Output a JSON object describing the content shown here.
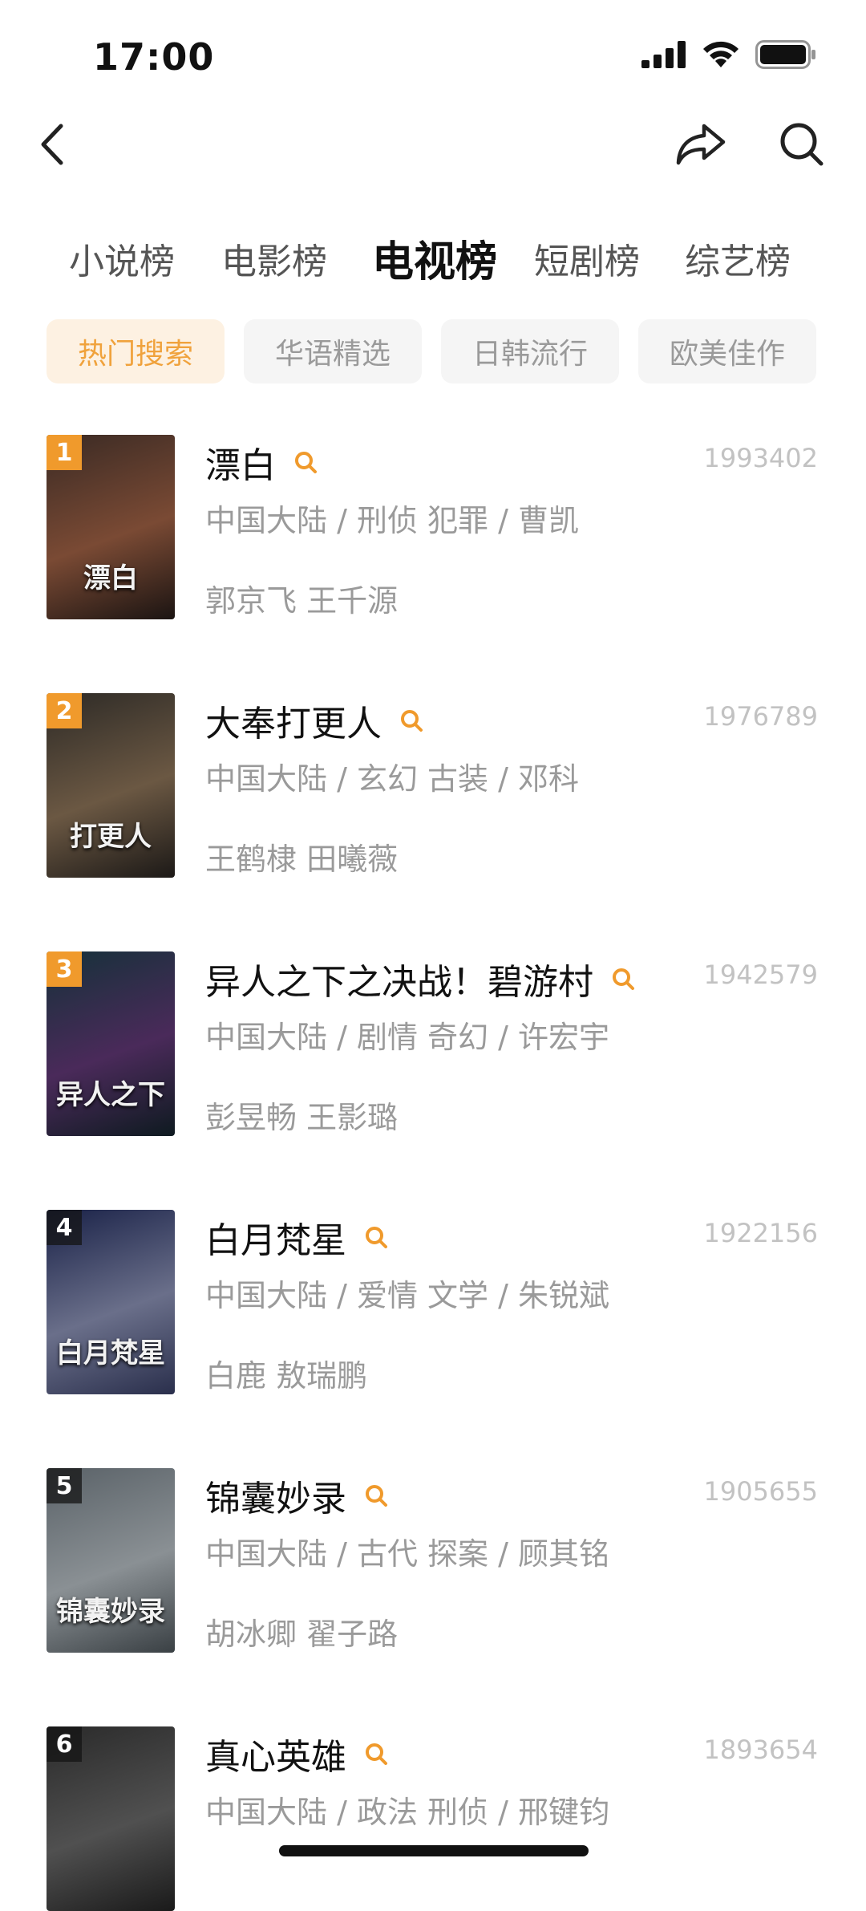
{
  "status": {
    "time": "17:00"
  },
  "tabs": [
    {
      "label": "小说榜",
      "active": false
    },
    {
      "label": "电影榜",
      "active": false
    },
    {
      "label": "电视榜",
      "active": true
    },
    {
      "label": "短剧榜",
      "active": false
    },
    {
      "label": "综艺榜",
      "active": false
    }
  ],
  "chips": [
    {
      "label": "热门搜索",
      "active": true
    },
    {
      "label": "华语精选",
      "active": false
    },
    {
      "label": "日韩流行",
      "active": false
    },
    {
      "label": "欧美佳作",
      "active": false
    }
  ],
  "colors": {
    "accent": "#f09a2c",
    "chip_active_bg": "#fdf1e2",
    "chip_active_text": "#f0a23c"
  },
  "items": [
    {
      "rank": "1",
      "title": "漂白",
      "count": "1993402",
      "meta": "中国大陆 / 刑侦 犯罪 / 曹凯",
      "cast": "郭京飞 王千源",
      "poster_text": "漂白",
      "poster_colors": [
        "#3a2a24",
        "#7a4a34",
        "#1b1412"
      ]
    },
    {
      "rank": "2",
      "title": "大奉打更人",
      "count": "1976789",
      "meta": "中国大陆 / 玄幻 古装 / 邓科",
      "cast": "王鹤棣 田曦薇",
      "poster_text": "打更人",
      "poster_colors": [
        "#2d2a26",
        "#6b5843",
        "#1c1917"
      ]
    },
    {
      "rank": "3",
      "title": "异人之下之决战！碧游村",
      "count": "1942579",
      "meta": "中国大陆 / 剧情 奇幻 / 许宏宇",
      "cast": "彭昱畅 王影璐",
      "poster_text": "异人之下",
      "poster_colors": [
        "#16313a",
        "#4a2a5a",
        "#0e1a20"
      ]
    },
    {
      "rank": "4",
      "title": "白月梵星",
      "count": "1922156",
      "meta": "中国大陆 / 爱情 文学 / 朱锐斌",
      "cast": "白鹿 敖瑞鹏",
      "poster_text": "白月梵星",
      "poster_colors": [
        "#1a2248",
        "#6a6f8a",
        "#2a2f4c"
      ]
    },
    {
      "rank": "5",
      "title": "锦囊妙录",
      "count": "1905655",
      "meta": "中国大陆 / 古代 探案 / 顾其铭",
      "cast": "胡冰卿 翟子路",
      "poster_text": "锦囊妙录",
      "poster_colors": [
        "#5a6268",
        "#8a9094",
        "#3a4044"
      ]
    },
    {
      "rank": "6",
      "title": "真心英雄",
      "count": "1893654",
      "meta": "中国大陆 / 政法 刑侦 / 邢键钧",
      "cast": "",
      "poster_text": "",
      "poster_colors": [
        "#2a2a2a",
        "#505050",
        "#1a1a1a"
      ]
    }
  ]
}
